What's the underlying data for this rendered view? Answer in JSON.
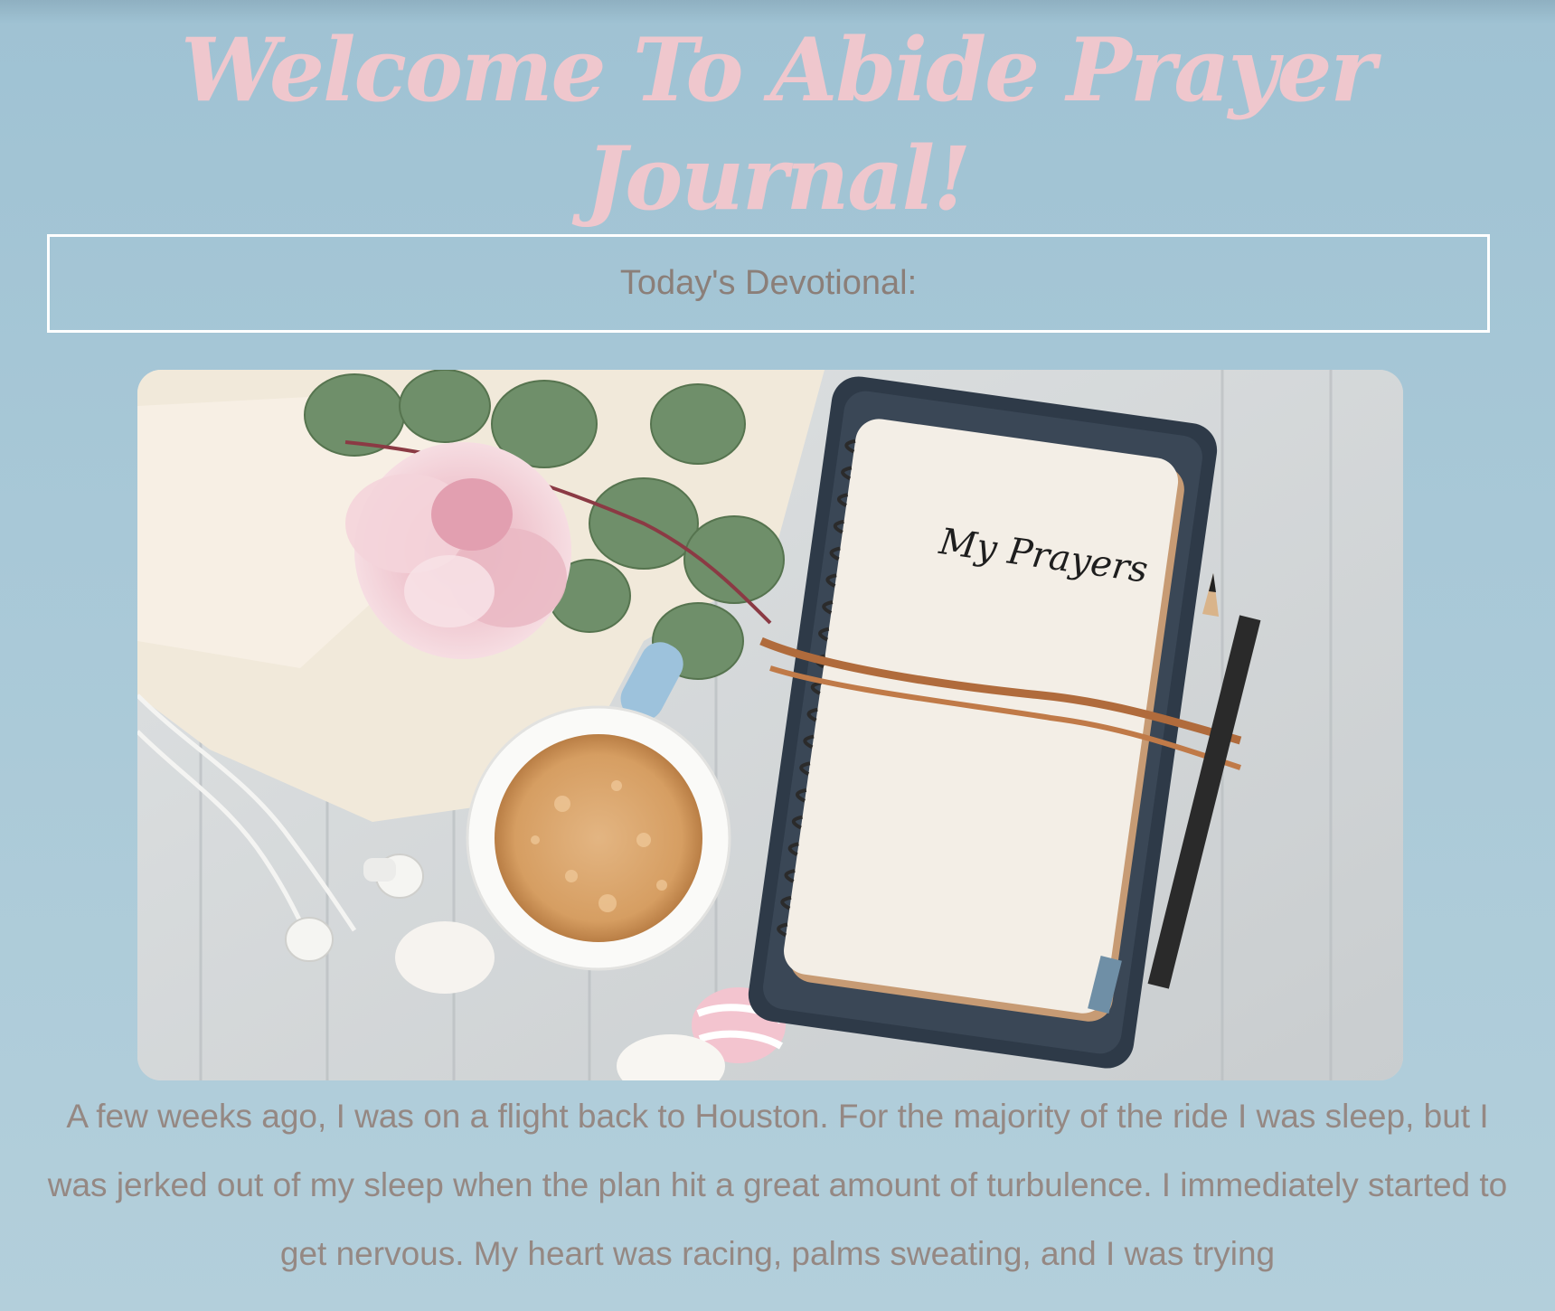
{
  "header": {
    "title": "Welcome To Abide Prayer Journal!"
  },
  "devotional": {
    "label": "Today's Devotional:"
  },
  "hero": {
    "image_name": "journal-flatlay-image",
    "notebook_text": "My Prayers"
  },
  "story": {
    "paragraph": "A few weeks ago, I was on a flight back to Houston. For the majority of the ride I was sleep, but I was jerked out of my sleep when the plan hit a great amount of turbulence. I immediately started to get nervous. My heart was racing, palms sweating, and I was trying"
  },
  "colors": {
    "background": "#a8c8d7",
    "title": "#efc7cd",
    "text": "#958883",
    "box_border": "#ffffff"
  }
}
